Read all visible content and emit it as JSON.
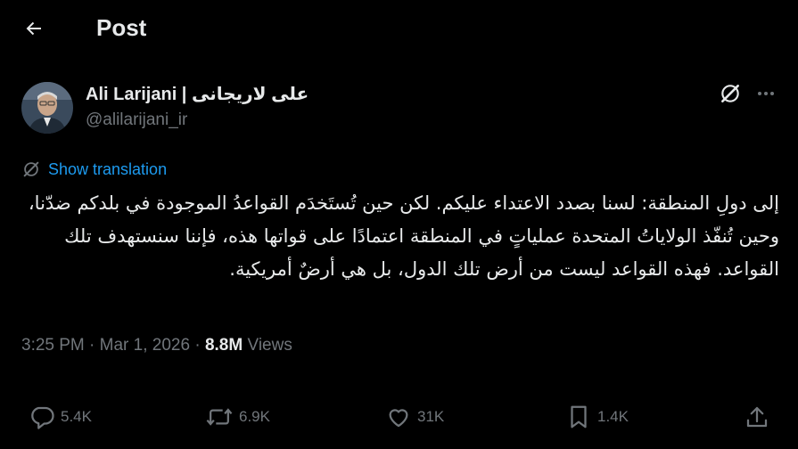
{
  "header": {
    "title": "Post"
  },
  "author": {
    "display_name": "Ali Larijani | علی لاریجانی",
    "handle": "@alilarijani_ir"
  },
  "translation": {
    "label": "Show translation"
  },
  "tweet": {
    "text": "إلى دولِ المنطقة: لسنا بصدد الاعتداء عليكم. لكن حين تُستَخدَم القواعدُ الموجودة في بلدكم ضدّنا، وحين تُنفّذ الولاياتُ المتحدة عملياتٍ في المنطقة اعتمادًا على قواتها هذه، فإننا سنستهدف تلك القواعد. فهذه القواعد ليست من أرض تلك الدول، بل هي أرضٌ أمريكية."
  },
  "meta": {
    "time": "3:25 PM",
    "date": "Mar 1, 2026",
    "views_count": "8.8M",
    "views_label": "Views"
  },
  "actions": {
    "replies": "5.4K",
    "reposts": "6.9K",
    "likes": "31K",
    "bookmarks": "1.4K"
  },
  "icons": [
    "back-arrow-icon",
    "grok-icon",
    "more-icon",
    "translate-icon",
    "reply-icon",
    "repost-icon",
    "like-icon",
    "bookmark-icon",
    "share-icon"
  ],
  "colors": {
    "background": "#000000",
    "text": "#e7e9ea",
    "muted": "#71767b",
    "link": "#1d9bf0"
  }
}
